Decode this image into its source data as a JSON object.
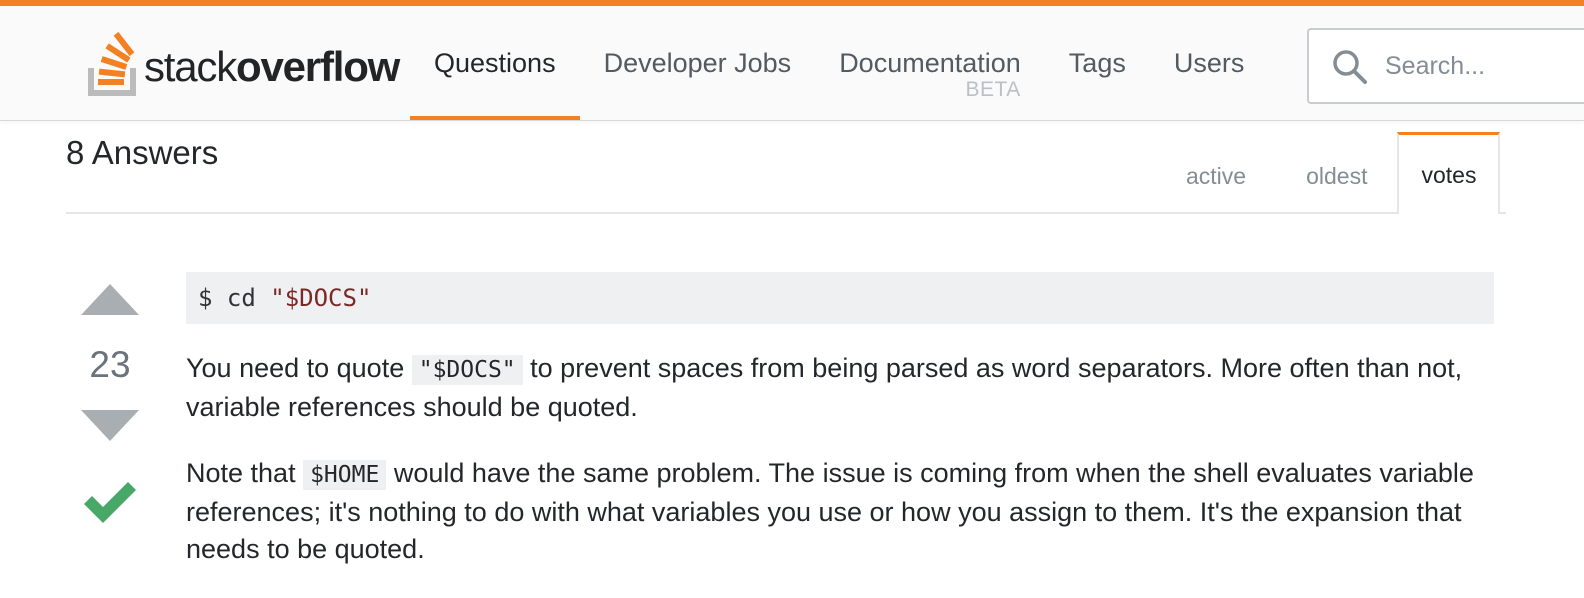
{
  "colors": {
    "accent": "#f48024",
    "vote_arrow": "#a9aeb2",
    "accepted": "#48a868",
    "code_string": "#7d2727"
  },
  "header": {
    "logo": {
      "light": "stack",
      "bold": "overflow"
    },
    "nav": [
      {
        "label": "Questions",
        "active": true
      },
      {
        "label": "Developer Jobs",
        "active": false
      },
      {
        "label": "Documentation",
        "badge": "BETA",
        "active": false
      },
      {
        "label": "Tags",
        "active": false
      },
      {
        "label": "Users",
        "active": false
      }
    ],
    "search": {
      "placeholder": "Search...",
      "icon": "search-icon"
    }
  },
  "answers": {
    "title": "8 Answers",
    "sort_tabs": [
      {
        "label": "active",
        "active": false
      },
      {
        "label": "oldest",
        "active": false
      },
      {
        "label": "votes",
        "active": true
      }
    ]
  },
  "answer": {
    "vote_count": "23",
    "accepted": true,
    "code": {
      "prompt": "$ cd ",
      "string": "\"$DOCS\""
    },
    "paragraph1": {
      "before": "You need to quote ",
      "code": "\"$DOCS\"",
      "after": " to prevent spaces from being parsed as word separators. More often than not, variable references should be quoted."
    },
    "paragraph2": {
      "before": "Note that ",
      "code": "$HOME",
      "after": " would have the same problem. The issue is coming from when the shell evaluates variable references; it's nothing to do with what variables you use or how you assign to them. It's the expansion that needs to be quoted."
    }
  }
}
